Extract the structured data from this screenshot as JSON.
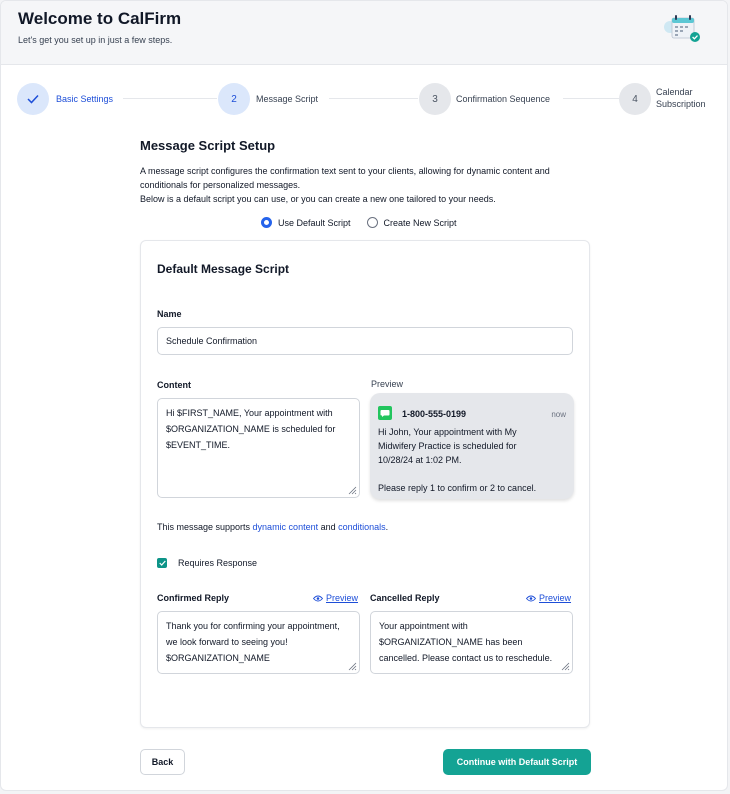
{
  "header": {
    "title": "Welcome to CalFirm",
    "subtitle": "Let's get you set up in just a few steps."
  },
  "steps": [
    {
      "number": "",
      "label": "Basic Settings",
      "status": "completed"
    },
    {
      "number": "2",
      "label": "Message Script",
      "status": "active"
    },
    {
      "number": "3",
      "label": "Confirmation Sequence",
      "status": "pending"
    },
    {
      "number": "4",
      "label_line1": "Calendar",
      "label_line2": "Subscription",
      "status": "pending"
    }
  ],
  "page": {
    "title": "Message Script Setup",
    "desc_line1": "A message script configures the confirmation text sent to your clients, allowing for dynamic content and",
    "desc_line2": "conditionals for personalized messages.",
    "desc_line3": "Below is a default script you can use, or you can create a new one tailored to your needs."
  },
  "script_choice": {
    "options": [
      "Use Default Script",
      "Create New Script"
    ],
    "selected": "Use Default Script"
  },
  "card": {
    "title": "Default Message Script",
    "name_label": "Name",
    "name_value": "Schedule Confirmation",
    "content_label": "Content",
    "content_value": "Hi $FIRST_NAME, Your appointment with $ORGANIZATION_NAME is scheduled for $EVENT_TIME.",
    "preview_label": "Preview",
    "support_prefix": "This message supports ",
    "support_link1": "dynamic content",
    "support_mid": " and ",
    "support_link2": "conditionals",
    "support_suffix": ".",
    "requires_response_label": "Requires Response",
    "requires_response": true,
    "confirmed_label": "Confirmed Reply",
    "confirmed_value": "Thank you for confirming your appointment, we look forward to seeing you!\n$ORGANIZATION_NAME",
    "cancelled_label": "Cancelled Reply",
    "cancelled_value": "Your appointment with $ORGANIZATION_NAME has been cancelled. Please contact us to reschedule.",
    "preview_link": "Preview"
  },
  "preview": {
    "phone": "1-800-555-0199",
    "time": "now",
    "text": "Hi John, Your appointment with My\nMidwifery Practice is scheduled for\n10/28/24 at 1:02 PM.\n\nPlease reply 1 to confirm or 2 to cancel."
  },
  "buttons": {
    "back": "Back",
    "continue": "Continue with Default Script"
  },
  "colors": {
    "accent_blue": "#1d4ed8",
    "teal": "#14a394"
  }
}
